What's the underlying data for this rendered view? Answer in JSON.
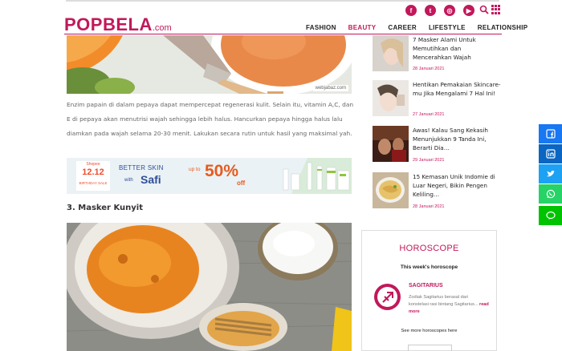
{
  "brand": {
    "name": "POPBELA",
    "suffix": ".com",
    "color": "#c2185b"
  },
  "social": [
    {
      "icon": "facebook-icon",
      "glyph": "f"
    },
    {
      "icon": "twitter-icon",
      "glyph": "t"
    },
    {
      "icon": "instagram-icon",
      "glyph": "◎"
    },
    {
      "icon": "youtube-icon",
      "glyph": "▶"
    }
  ],
  "nav": [
    {
      "label": "FASHION",
      "active": false
    },
    {
      "label": "BEAUTY",
      "active": true
    },
    {
      "label": "CAREER",
      "active": false
    },
    {
      "label": "LIFESTYLE",
      "active": false
    },
    {
      "label": "RELATIONSHIP",
      "active": false
    }
  ],
  "article": {
    "image1_credit": "webjabaz.com",
    "paragraph": "Enzim papain di dalam pepaya dapat mempercepat regenerasi kulit. Selain itu, vitamin A,C, dan E di pepaya akan menutrisi wajah sehingga lebih halus. Hancurkan pepaya hingga halus lalu diamkan pada wajah selama 20-30 menit. Lakukan secara rutin untuk hasil yang maksimal yah.",
    "subheading": "3. Masker Kunyit"
  },
  "banner": {
    "shopee_label": "Shopee",
    "sale_date": "12.12",
    "sale_caption": "BIRTHDAY SALE",
    "headline": "BETTER SKIN",
    "with_text": "with",
    "brand": "Safi",
    "upto": "up to",
    "discount": "50%",
    "off": "off"
  },
  "sidebar": [
    {
      "title": "7 Masker Alami Untuk Memutihkan dan Mencerahkan Wajah",
      "date": "28 Januari 2021"
    },
    {
      "title": "Hentikan Pemakaian Skincare-mu Jika Mengalami 7 Hal Ini!",
      "date": "27 Januari 2021"
    },
    {
      "title": "Awas! Kalau Sang Kekasih Menunjukkan 9 Tanda Ini, Berarti Dia…",
      "date": "29 Januari 2021"
    },
    {
      "title": "15 Kemasan Unik Indomie di Luar Negeri, Bikin Pengen Keliling…",
      "date": "28 Januari 2021"
    }
  ],
  "horoscope": {
    "title": "HOROSCOPE",
    "week": "This week's horoscope",
    "sign": "SAGITARIUS",
    "desc": "Zodiak Sagitarius berasal dari konstelasi rasi bintang Sagitarius...",
    "more": "read more",
    "see_more": "See more horoscopes here"
  },
  "share": [
    {
      "icon": "facebook-share-icon",
      "color": "#1877f2"
    },
    {
      "icon": "linkedin-share-icon",
      "color": "#0a66c2"
    },
    {
      "icon": "twitter-share-icon",
      "color": "#1da1f2"
    },
    {
      "icon": "whatsapp-share-icon",
      "color": "#25d366"
    },
    {
      "icon": "line-share-icon",
      "color": "#00c300"
    }
  ]
}
